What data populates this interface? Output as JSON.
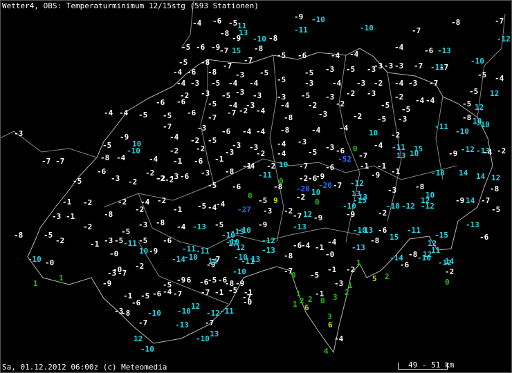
{
  "header": {
    "title": "Wetter4, OBS: Temperaturminimum 12/15stg (593 Stationen)"
  },
  "footer": {
    "timestamp": "Sa, 01.12.2012 06:00z (c) Meteomedia",
    "scale_label": "49 - 51 km"
  },
  "colors": {
    "background": "#000000",
    "border": "#b0b0b0",
    "normal": "#ffffff",
    "cold": "#22d8e8",
    "very_cold": "#2a6cff",
    "positive": "#22c010",
    "warm": "#c8e400"
  },
  "stations": [
    "-4",
    "-6",
    "-5",
    "11",
    "13",
    "-8",
    "-9",
    "-10",
    "-8",
    "-9",
    "-11",
    "-10",
    "-10",
    "-7",
    "-8",
    "-7",
    "-12",
    "-5",
    "-6",
    "-9",
    "-7",
    "15",
    "-8",
    "-4",
    "-6",
    "-13",
    "-10",
    "-5",
    "-8",
    "-7",
    "-7",
    "-5",
    "-6",
    "-4",
    "-4",
    "-3",
    "-3",
    "-3",
    "-7",
    "-11",
    "-7",
    "-4",
    "-6",
    "-8",
    "-3",
    "-5",
    "-5",
    "-3",
    "-5",
    "-3",
    "-5",
    "-4",
    "-4",
    "-3",
    "-5",
    "-4",
    "-4",
    "-5",
    "-3",
    "-4",
    "-3",
    "-2",
    "-4",
    "-3",
    "-7",
    "-5",
    "12",
    "-2",
    "-3",
    "-5",
    "-3",
    "-3",
    "-3",
    "-5",
    "-3",
    "-2",
    "-3",
    "-2",
    "-4",
    "-4",
    "-6",
    "-6",
    "-5",
    "-4",
    "-3",
    "-4",
    "-2",
    "-2",
    "-5",
    "-5",
    "-5",
    "12",
    "-4",
    "-4",
    "-5",
    "-5",
    "-6",
    "-7",
    "-7",
    "-2",
    "-4",
    "-8",
    "-3",
    "-2",
    "-5",
    "-3",
    "-8",
    "10",
    "-7",
    "-3",
    "-6",
    "-4",
    "-4",
    "-8",
    "-4",
    "-4",
    "10",
    "-2",
    "-11",
    "-10",
    "-10",
    "-3",
    "-9",
    "10",
    "-4",
    "-2",
    "-5",
    "-3",
    "-3",
    "-4",
    "-3",
    "-3",
    "0",
    "-4",
    "-11",
    "15",
    "-5",
    "-10",
    "-2",
    "-2",
    "-3",
    "-2",
    "-4",
    "-5",
    "-6",
    "-7",
    "13",
    "10",
    "-9",
    "-12",
    "-13",
    "-2",
    "-4",
    "-8",
    "-4",
    "-4",
    "-1",
    "-6",
    "-1",
    "-1",
    "-2",
    "10",
    "-7",
    "-6",
    "-52",
    "-1",
    "-1",
    "-7",
    "-7",
    "-6",
    "-3",
    "-2",
    "-2",
    "-3",
    "-6",
    "-3",
    "-8",
    "-4",
    "-11",
    "0",
    "-2",
    "-6",
    "-9",
    "-20",
    "-7",
    "-12",
    "-9",
    "-1",
    "-10",
    "14",
    "14",
    "12",
    "-5",
    "-2",
    "-2",
    "-2",
    "-5",
    "-6",
    "-8",
    "-20",
    "10",
    "13",
    "13",
    "-3",
    "-8",
    "10",
    "-8",
    "-1",
    "-2",
    "-2",
    "-4",
    "-2",
    "-5",
    "-4",
    "0",
    "-5",
    "9",
    "-2",
    "0",
    "-10",
    "-15",
    "12",
    "-9",
    "14",
    "-7",
    "-3",
    "-1",
    "-8",
    "-2",
    "-1",
    "-4",
    "-27",
    "-3",
    "-2",
    "12",
    "-7",
    "-9",
    "-9",
    "-2",
    "-10",
    "-12",
    "-12",
    "-5",
    "-5",
    "-2",
    "-5",
    "-3",
    "-8",
    "-4",
    "-13",
    "-5",
    "-13",
    "-10",
    "-9",
    "-13",
    "-10",
    "13",
    "-6",
    "-11",
    "-13",
    "-8",
    "-2",
    "-1",
    "-3",
    "-5",
    "-11",
    "-5",
    "-6",
    "-10",
    "-10",
    "17",
    "12",
    "-12",
    "-6",
    "-4",
    "-1",
    "-4",
    "-8",
    "15",
    "-15",
    "12",
    "-6",
    "-10",
    "-0",
    "-0",
    "10",
    "-9",
    "-11",
    "-11",
    "-14",
    "-10",
    "-7",
    "-10",
    "-13",
    "-8",
    "-0",
    "-13",
    "-14",
    "-8",
    "-10",
    "12",
    "11",
    "-12",
    "14",
    "-0",
    "-2",
    "-9",
    "14",
    "-11",
    "13",
    "-7",
    "-1",
    "1",
    "-2",
    "-6",
    "-2",
    "1",
    "1",
    "-9",
    "-3",
    "-7",
    "-5",
    "-9",
    "-6",
    "-6",
    "-5",
    "-6",
    "-8",
    "-10",
    "-9",
    "0",
    "-5",
    "-3",
    "5",
    "2",
    "0",
    "-1",
    "-5",
    "-6",
    "-4",
    "-7",
    "-7",
    "-1",
    "-5",
    "-7",
    "-1",
    "1",
    "-1",
    "1",
    "2",
    "-3",
    "-6",
    "-10",
    "-10",
    "12",
    "-12",
    "-11",
    "-0",
    "1",
    "2",
    "2",
    "6",
    "0",
    "3",
    "-8",
    "-7",
    "-13",
    "-7",
    "3",
    "6",
    "12",
    "-10",
    "-10",
    "13",
    "-4",
    "4"
  ]
}
